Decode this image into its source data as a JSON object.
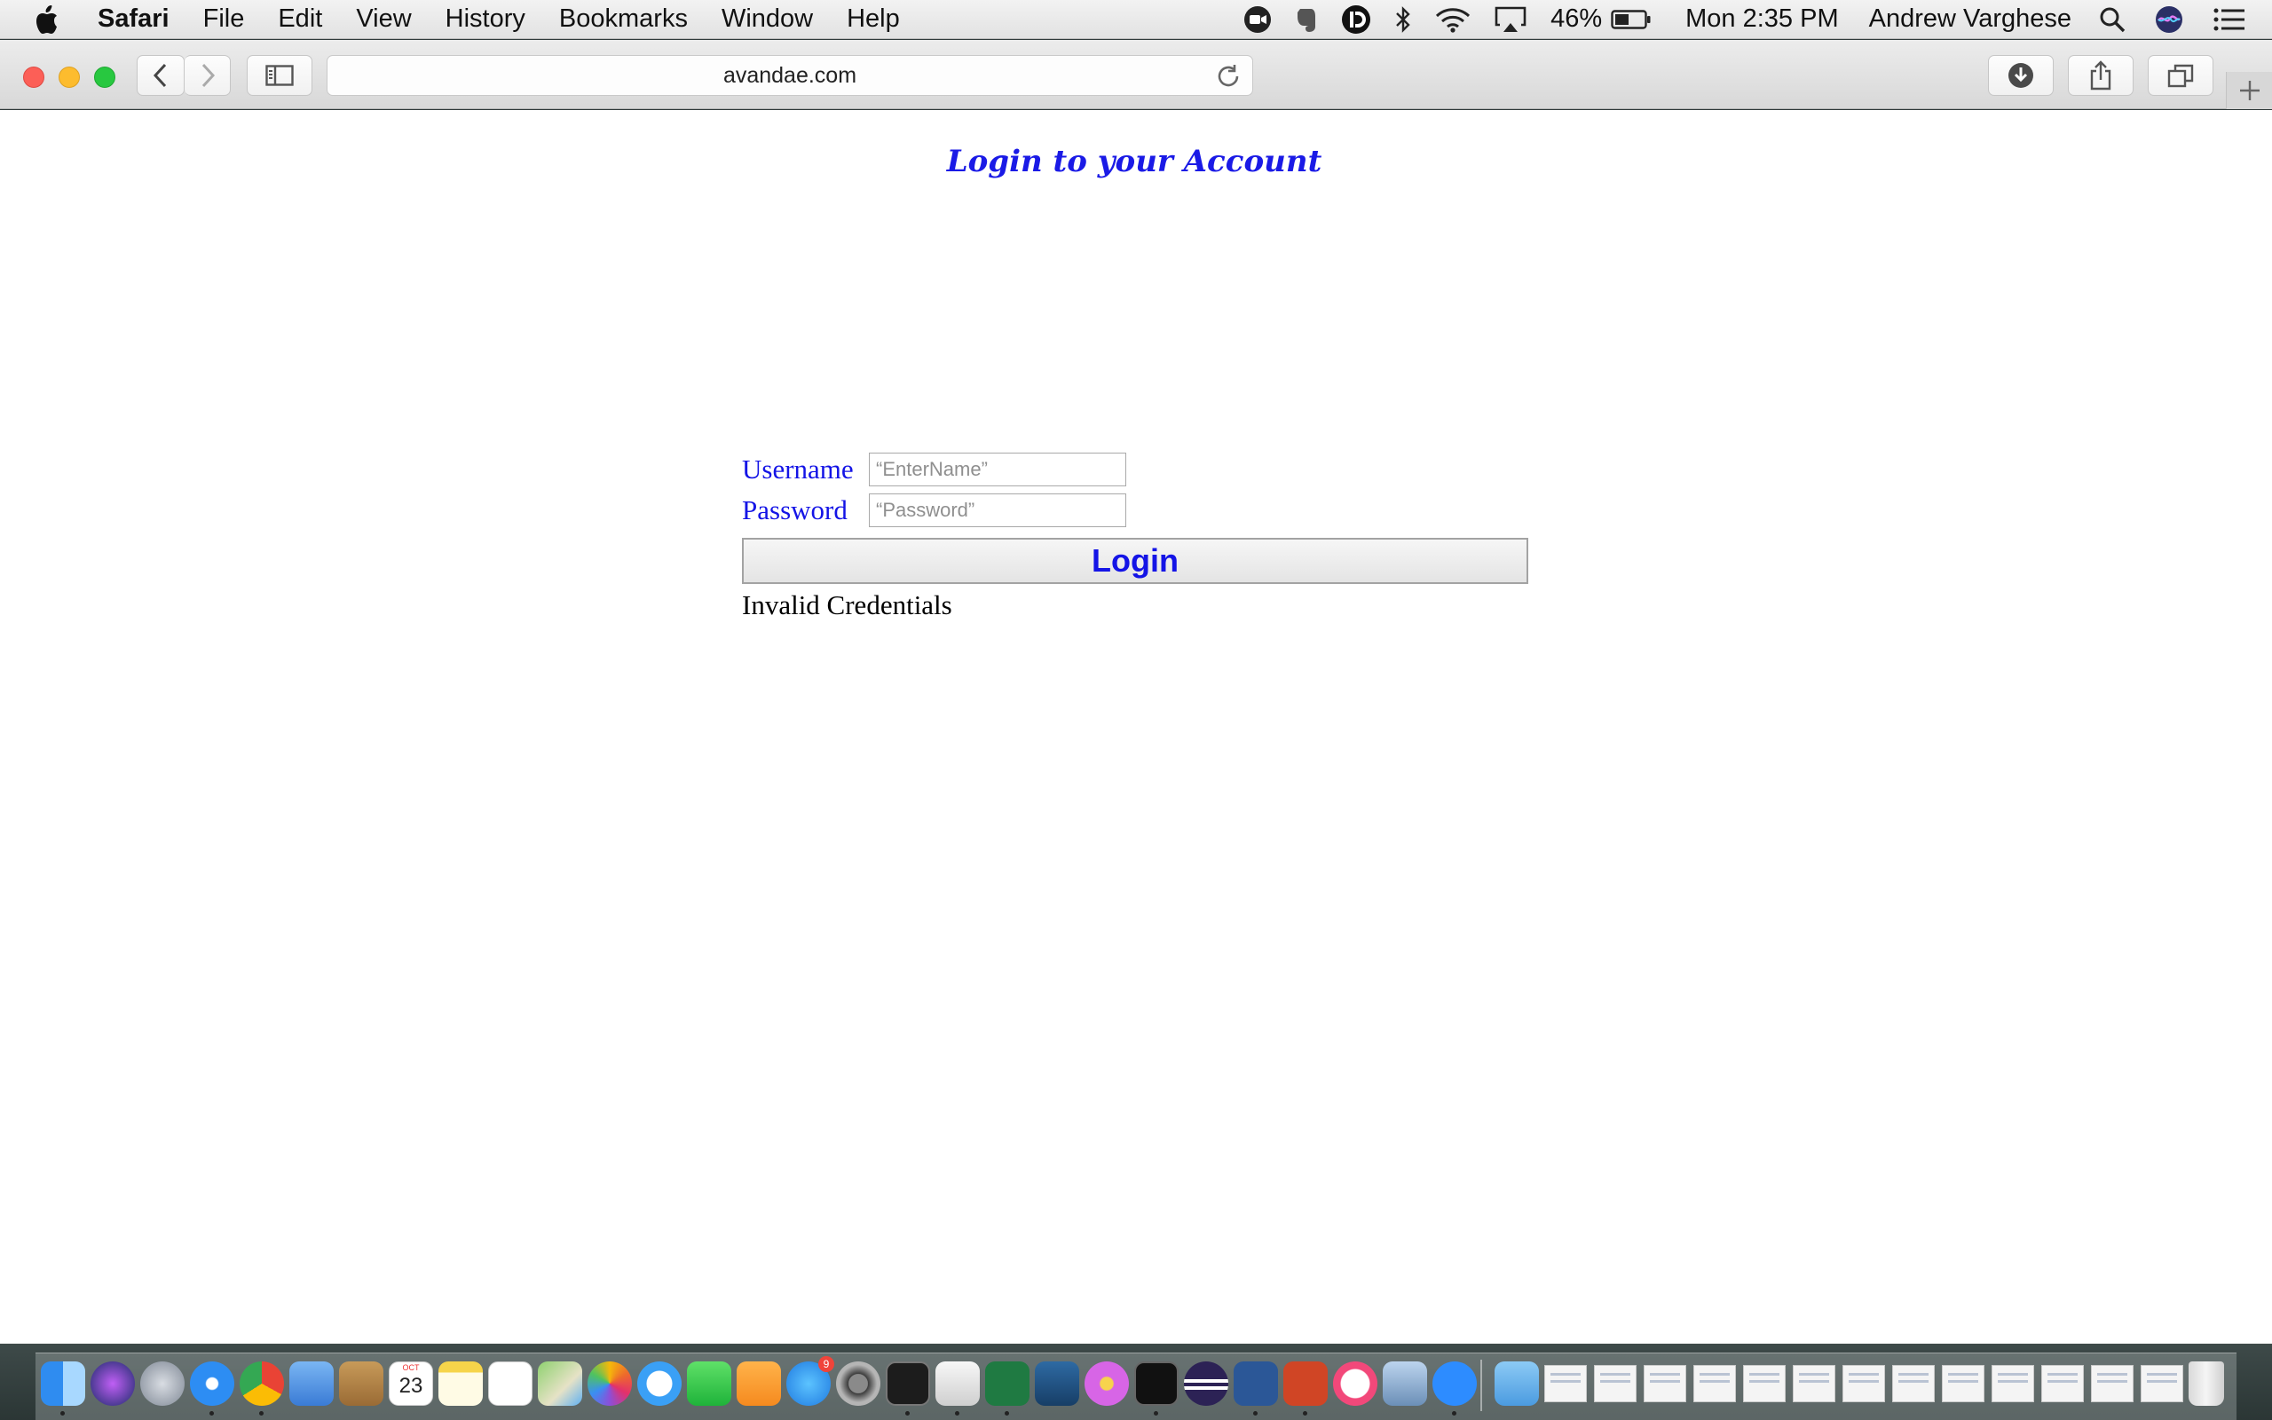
{
  "menubar": {
    "app_name": "Safari",
    "menus": [
      "File",
      "Edit",
      "View",
      "History",
      "Bookmarks",
      "Window",
      "Help"
    ],
    "battery_percent": "46%",
    "clock": "Mon 2:35 PM",
    "user_name": "Andrew Varghese",
    "status_icons": [
      "zoom-icon",
      "evernote-icon",
      "dashlane-icon",
      "bluetooth-icon",
      "wifi-icon",
      "airplay-icon",
      "battery-icon",
      "spotlight-icon",
      "siri-icon",
      "notification-center-icon"
    ]
  },
  "browser": {
    "url": "avandae.com",
    "toolbar_icons": [
      "back-icon",
      "forward-icon",
      "sidebar-icon",
      "reload-icon",
      "downloads-icon",
      "share-icon",
      "tabs-icon",
      "new-tab-icon"
    ]
  },
  "page": {
    "title": "Login to your Account",
    "username_label": "Username",
    "username_placeholder": "“EnterName”",
    "password_label": "Password",
    "password_placeholder": "“Password”",
    "login_label": "Login",
    "error_message": "Invalid Credentials"
  },
  "dock": {
    "calendar_month": "OCT",
    "calendar_day": "23",
    "appstore_badge": "9",
    "apps": [
      "finder-icon",
      "siri-icon",
      "launchpad-icon",
      "safari-icon",
      "chrome-icon",
      "preview-icon",
      "contacts-icon",
      "calendar-icon",
      "notes-icon",
      "reminders-icon",
      "maps-icon",
      "photos-icon",
      "messages-icon",
      "facetime-icon",
      "pages-icon",
      "app-store-icon",
      "system-preferences-icon",
      "terminal-icon",
      "sublime-text-icon",
      "excel-icon",
      "mysql-workbench-icon",
      "flower-app-icon",
      "activity-monitor-icon",
      "eclipse-icon",
      "word-icon",
      "powerpoint-icon",
      "itunes-icon",
      "preview-window-icon",
      "zoom-icon",
      "downloads-folder-icon"
    ]
  }
}
